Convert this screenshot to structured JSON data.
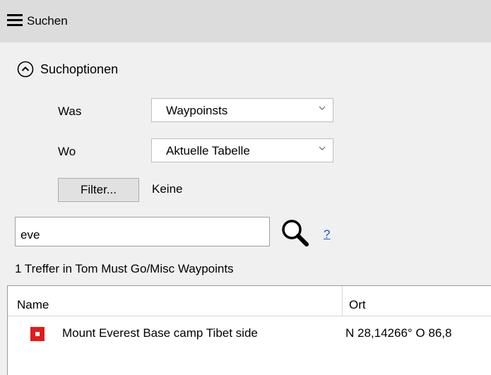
{
  "header": {
    "title": "Suchen"
  },
  "options": {
    "label": "Suchoptionen",
    "was": {
      "label": "Was",
      "value": "Waypoinsts"
    },
    "wo": {
      "label": "Wo",
      "value": "Aktuelle Tabelle"
    },
    "filter": {
      "button_label": "Filter...",
      "value": "Keine"
    }
  },
  "search": {
    "value": "eve",
    "help_label": "?"
  },
  "results": {
    "summary": "1 Treffer  in Tom Must Go/Misc Waypoints"
  },
  "table": {
    "columns": [
      "Name",
      "Ort"
    ],
    "rows": [
      {
        "name": "Mount Everest Base camp Tibet side",
        "ort": "N 28,14266° O 86,8",
        "icon_color": "#e41a1c"
      }
    ]
  }
}
